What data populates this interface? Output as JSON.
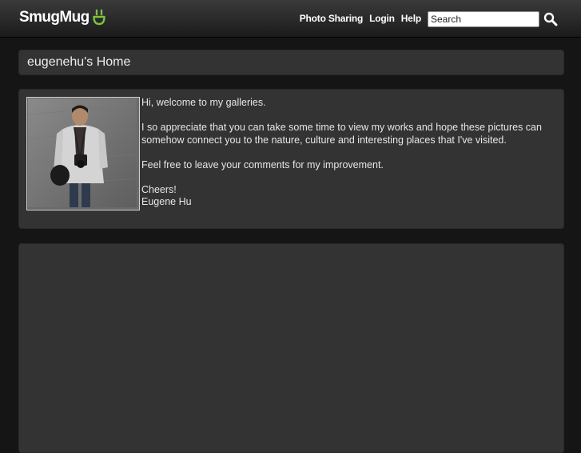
{
  "header": {
    "logo_text": "SmugMug",
    "logo_icon": "smugmug-smile-icon",
    "nav": [
      {
        "label": "Photo Sharing"
      },
      {
        "label": "Login"
      },
      {
        "label": "Help"
      }
    ],
    "search": {
      "placeholder": "Search",
      "value": "",
      "button_icon": "magnifier-icon"
    }
  },
  "page": {
    "title": "eugenehu's Home"
  },
  "bio": {
    "photo": "portrait of man with camera (photo)",
    "paragraphs": [
      "Hi, welcome to my galleries.",
      "I so appreciate that you can take some time to view my works and hope these pictures can somehow connect you to the nature, culture and interesting places that I've visited.",
      "Feel free to leave your comments for my improvement."
    ],
    "signoff": "Cheers!",
    "signature": "Eugene Hu"
  },
  "colors": {
    "background": "#151515",
    "panel": "#333333",
    "logo_accent": "#7dc242"
  }
}
